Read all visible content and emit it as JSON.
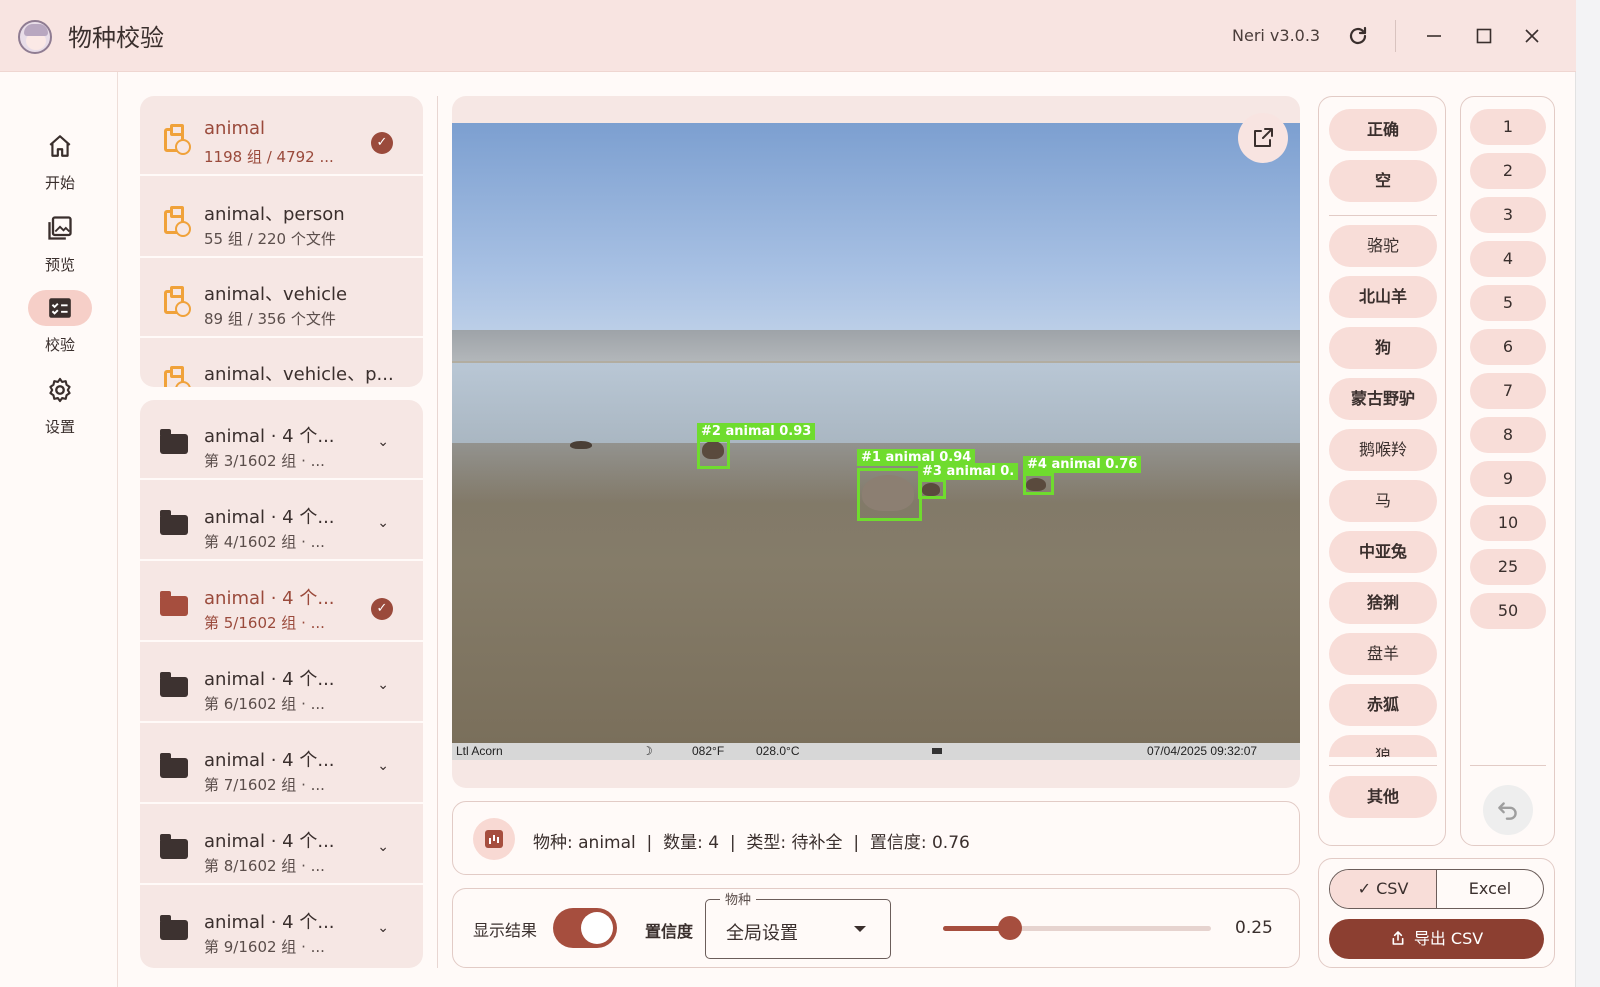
{
  "app": {
    "title": "物种校验",
    "version": "Neri v3.0.3"
  },
  "nav": [
    {
      "label": "开始",
      "icon": "home-icon"
    },
    {
      "label": "预览",
      "icon": "gallery-icon"
    },
    {
      "label": "校验",
      "icon": "checklist-icon",
      "active": true
    },
    {
      "label": "设置",
      "icon": "gear-icon"
    }
  ],
  "categories": [
    {
      "title": "animal",
      "sub": "1198 组 / 4792 ...",
      "selected": true
    },
    {
      "title": "animal、person",
      "sub": "55 组 / 220 个文件"
    },
    {
      "title": "animal、vehicle",
      "sub": "89 组 / 356 个文件"
    },
    {
      "title": "animal、vehicle、p...",
      "sub": ""
    }
  ],
  "groups": [
    {
      "title": "animal · 4 个...",
      "sub": "第 3/1602 组 · ..."
    },
    {
      "title": "animal · 4 个...",
      "sub": "第 4/1602 组 · ..."
    },
    {
      "title": "animal · 4 个...",
      "sub": "第 5/1602 组 · ...",
      "selected": true
    },
    {
      "title": "animal · 4 个...",
      "sub": "第 6/1602 组 · ..."
    },
    {
      "title": "animal · 4 个...",
      "sub": "第 7/1602 组 · ..."
    },
    {
      "title": "animal · 4 个...",
      "sub": "第 8/1602 组 · ..."
    },
    {
      "title": "animal · 4 个...",
      "sub": "第 9/1602 组 · ..."
    }
  ],
  "image": {
    "detections": [
      "#1 animal 0.94",
      "#2 animal 0.93",
      "#3 animal 0.",
      "#4 animal 0.76"
    ],
    "camera": {
      "brand": "Ltl Acorn",
      "temp_f": "082°F",
      "temp_c": "028.0°C",
      "datetime": "07/04/2025 09:32:07"
    }
  },
  "info": {
    "text": "物种: animal  |  数量: 4  |  类型: 待补全  |  置信度: 0.76"
  },
  "controls": {
    "show_results_label": "显示结果",
    "confidence_label": "置信度",
    "species_legend": "物种",
    "species_value": "全局设置",
    "slider_value": "0.25",
    "slider_fraction": 0.25
  },
  "species_buttons": {
    "top": [
      "正确",
      "空"
    ],
    "list": [
      "骆驼",
      "北山羊",
      "狗",
      "蒙古野驴",
      "鹅喉羚",
      "马",
      "中亚兔",
      "猞猁",
      "盘羊",
      "赤狐",
      "狼"
    ],
    "bold": [
      false,
      true,
      true,
      true,
      false,
      false,
      true,
      true,
      false,
      true,
      false
    ],
    "other": "其他"
  },
  "numbers": [
    "1",
    "2",
    "3",
    "4",
    "5",
    "6",
    "7",
    "8",
    "9",
    "10",
    "25",
    "50"
  ],
  "export": {
    "csv": "CSV",
    "excel": "Excel",
    "button": "导出 CSV",
    "check": "✓"
  },
  "colors": {
    "accent": "#a64e3e",
    "detection": "#6fdc2e",
    "titlebar": "#f8e4e1"
  }
}
